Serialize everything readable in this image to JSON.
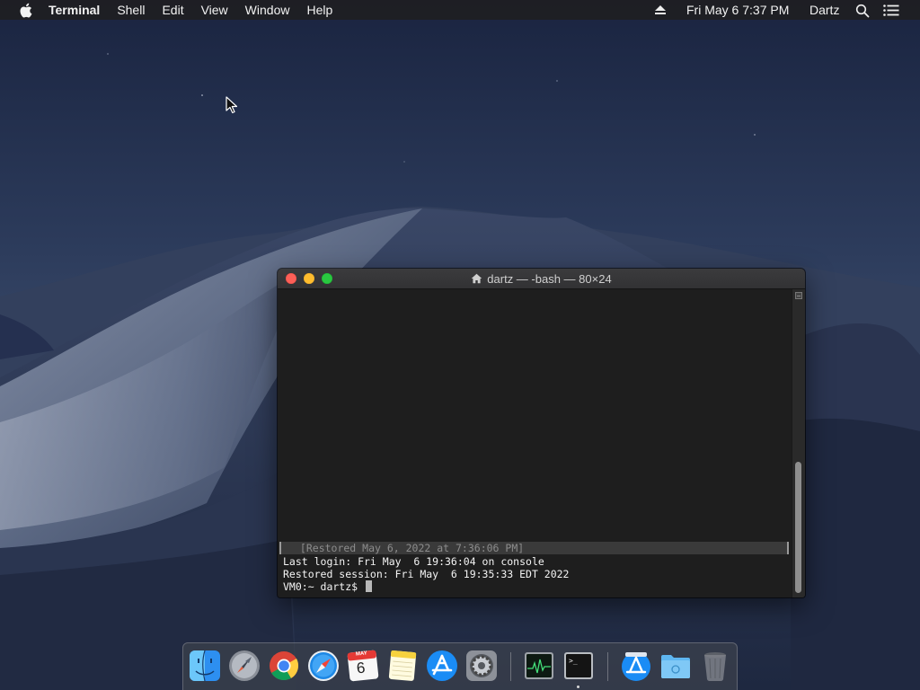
{
  "menubar": {
    "apple_icon": "apple-logo-icon",
    "app_name": "Terminal",
    "items": [
      "Shell",
      "Edit",
      "View",
      "Window",
      "Help"
    ],
    "clock": "Fri May 6  7:37 PM",
    "user": "Dartz",
    "status_icons": [
      "eject-icon",
      "spotlight-search-icon",
      "notification-center-icon"
    ]
  },
  "terminal": {
    "title": "dartz — -bash — 80×24",
    "title_icon": "home-icon",
    "restored_banner": " [Restored May 6, 2022 at 7:36:06 PM]",
    "lines": [
      "Last login: Fri May  6 19:36:04 on console",
      "Restored session: Fri May  6 19:35:33 EDT 2022",
      "VM0:~ dartz$ "
    ]
  },
  "calendar_icon": {
    "month": "MAY",
    "day": "6"
  },
  "dock": {
    "items": [
      {
        "name": "Finder",
        "icon": "finder-icon"
      },
      {
        "name": "Launchpad",
        "icon": "launchpad-icon"
      },
      {
        "name": "Google Chrome",
        "icon": "chrome-icon"
      },
      {
        "name": "Safari",
        "icon": "safari-icon"
      },
      {
        "name": "Calendar",
        "icon": "calendar-icon"
      },
      {
        "name": "Notes",
        "icon": "notes-icon"
      },
      {
        "name": "App Store",
        "icon": "app-store-icon"
      },
      {
        "name": "System Preferences",
        "icon": "system-preferences-icon"
      },
      {
        "name": "Activity Monitor",
        "icon": "activity-monitor-icon"
      },
      {
        "name": "Terminal",
        "icon": "terminal-icon",
        "running": true
      },
      {
        "name": "App Store Downloads",
        "icon": "downloads-stack-icon"
      },
      {
        "name": "Documents",
        "icon": "folder-icon"
      },
      {
        "name": "Trash",
        "icon": "trash-icon"
      }
    ]
  },
  "colors": {
    "close": "#fd5f57",
    "minimize": "#febc2e",
    "zoom": "#29c840",
    "terminal_bg": "#1e1e1e"
  }
}
